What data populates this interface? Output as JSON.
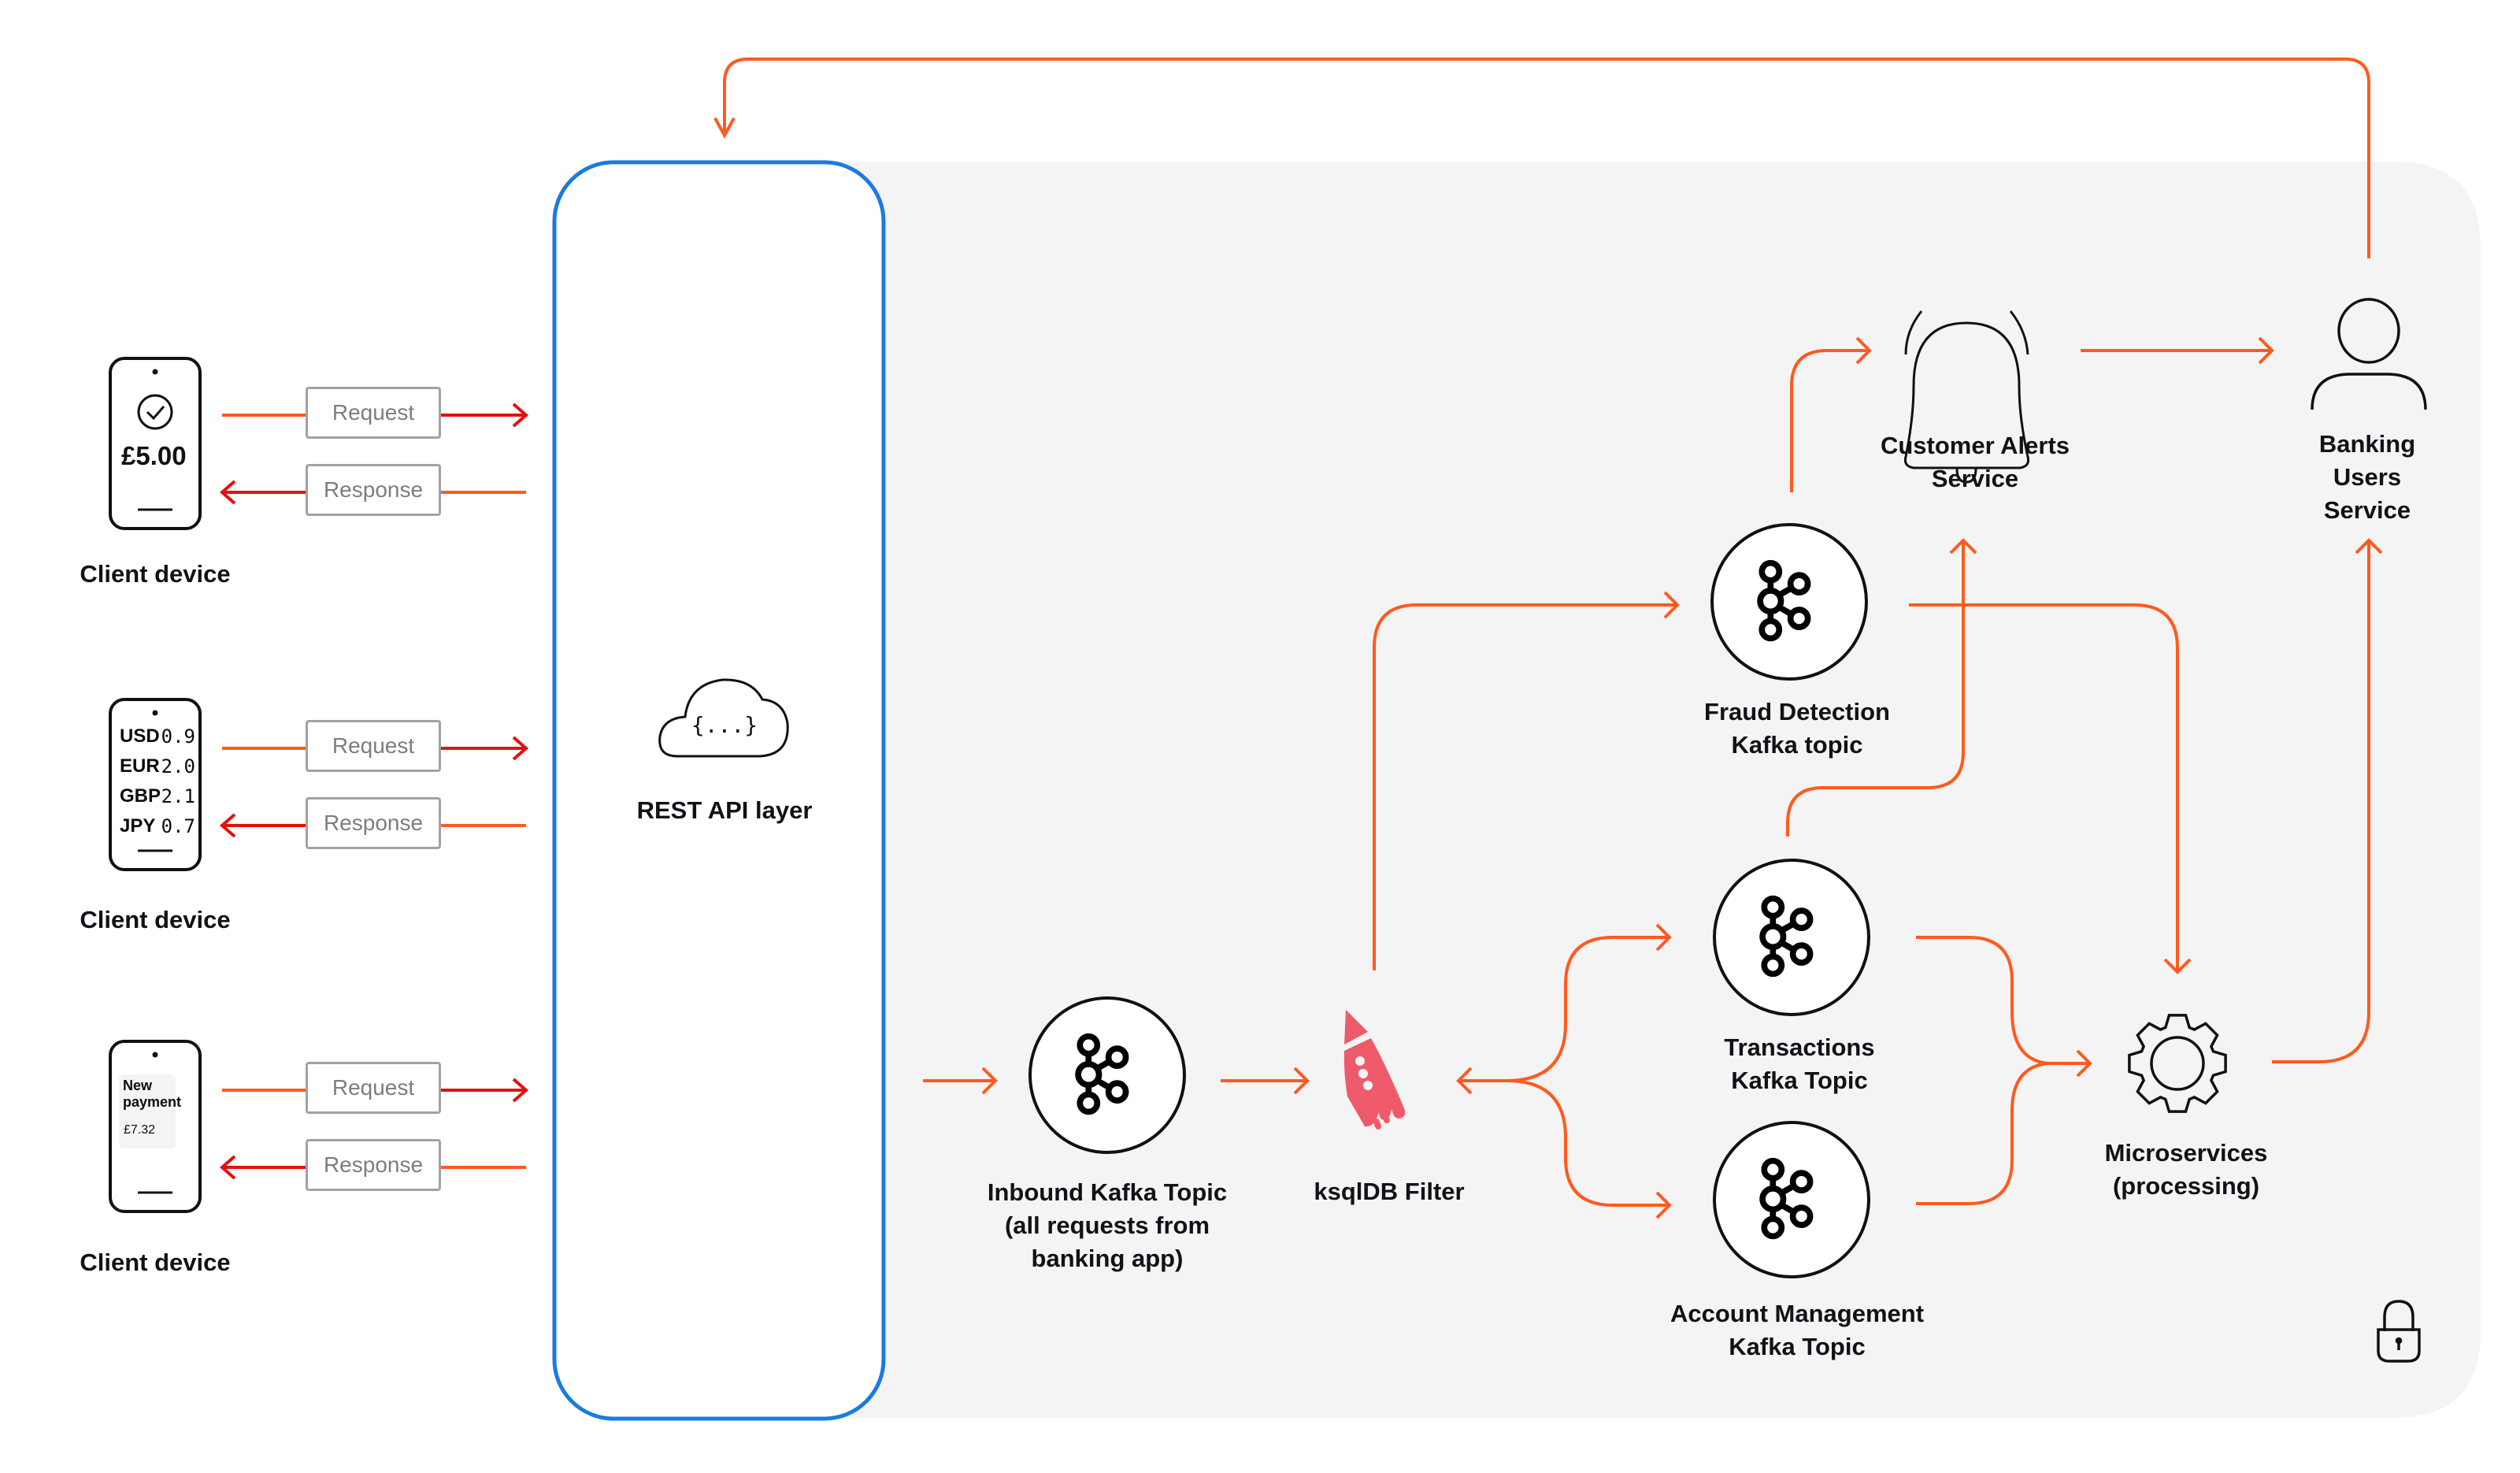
{
  "colors": {
    "flow_arrow": "#ff5a1f",
    "request_arrow": "#e3110e",
    "api_border": "#1a7be0",
    "platform_bg": "#f4f4f4",
    "ksqldb_rocket": "#ef5a6a",
    "box_border": "#a2a2a2",
    "box_text": "#7d7d7d",
    "text": "#111117"
  },
  "clients": [
    {
      "label": "Client device",
      "screen": {
        "type": "payment-confirmed",
        "icon": "check-circle-icon",
        "amount": "£5.00"
      },
      "request_label": "Request",
      "response_label": "Response"
    },
    {
      "label": "Client device",
      "screen": {
        "type": "exchange-rates",
        "rates": [
          {
            "currency": "USD",
            "value": "0.9"
          },
          {
            "currency": "EUR",
            "value": "2.0"
          },
          {
            "currency": "GBP",
            "value": "2.1"
          },
          {
            "currency": "JPY",
            "value": "0.7"
          }
        ]
      },
      "request_label": "Request",
      "response_label": "Response"
    },
    {
      "label": "Client device",
      "screen": {
        "type": "new-payment",
        "title": "New payment",
        "amount": "£7.32"
      },
      "request_label": "Request",
      "response_label": "Response"
    }
  ],
  "api_layer": {
    "label": "REST API layer",
    "icon": "cloud-code-icon",
    "icon_text": "{...}"
  },
  "nodes": {
    "inbound_topic": {
      "label": "Inbound Kafka Topic\n(all requests from\nbanking app)",
      "icon": "kafka-icon"
    },
    "ksqldb_filter": {
      "label": "ksqlDB Filter",
      "icon": "rocket-icon"
    },
    "fraud_topic": {
      "label": "Fraud Detection\nKafka topic",
      "icon": "kafka-icon"
    },
    "transactions_topic": {
      "label": "Transactions\nKafka Topic",
      "icon": "kafka-icon"
    },
    "account_topic": {
      "label": "Account Management\nKafka Topic",
      "icon": "kafka-icon"
    },
    "alerts_service": {
      "label": "Customer Alerts\nService",
      "icon": "bell-icon"
    },
    "users_service": {
      "label": "Banking\nUsers Service",
      "icon": "user-icon"
    },
    "microservices": {
      "label": "Microservices\n(processing)",
      "icon": "gear-icon"
    },
    "security": {
      "icon": "lock-icon"
    }
  },
  "flows": [
    {
      "from": "Client device",
      "to": "REST API layer",
      "label": "Request"
    },
    {
      "from": "REST API layer",
      "to": "Client device",
      "label": "Response"
    },
    {
      "from": "REST API layer",
      "to": "Inbound Kafka Topic"
    },
    {
      "from": "Inbound Kafka Topic",
      "to": "ksqlDB Filter"
    },
    {
      "from": "ksqlDB Filter",
      "to": "Fraud Detection Kafka topic"
    },
    {
      "from": "ksqlDB Filter",
      "to": "Transactions Kafka Topic",
      "bidirectional": true
    },
    {
      "from": "ksqlDB Filter",
      "to": "Account Management Kafka Topic",
      "bidirectional": true
    },
    {
      "from": "Fraud Detection Kafka topic",
      "to": "Customer Alerts Service"
    },
    {
      "from": "Fraud Detection Kafka topic",
      "to": "Microservices (processing)"
    },
    {
      "from": "Transactions Kafka Topic",
      "to": "Customer Alerts Service"
    },
    {
      "from": "Transactions Kafka Topic",
      "to": "Microservices (processing)"
    },
    {
      "from": "Account Management Kafka Topic",
      "to": "Microservices (processing)"
    },
    {
      "from": "Customer Alerts Service",
      "to": "Banking Users Service"
    },
    {
      "from": "Microservices (processing)",
      "to": "Banking Users Service"
    },
    {
      "from": "Banking Users Service",
      "to": "REST API layer"
    }
  ]
}
